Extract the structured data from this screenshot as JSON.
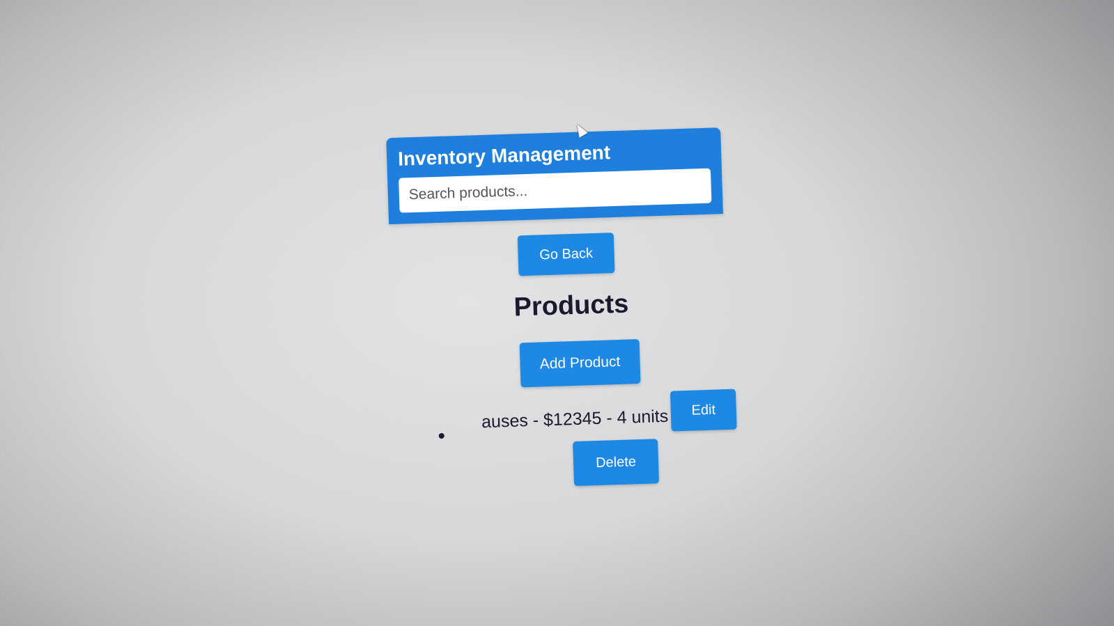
{
  "header": {
    "title": "Inventory Management",
    "search_placeholder": "Search products..."
  },
  "actions": {
    "go_back_label": "Go Back",
    "add_product_label": "Add Product"
  },
  "products_section": {
    "heading": "Products",
    "items": [
      {
        "text": "auses - $12345 - 4 units",
        "edit_label": "Edit",
        "delete_label": "Delete"
      }
    ]
  },
  "colors": {
    "header_bg": "#1e7fdc",
    "button_bg": "#1e88e5",
    "button_text": "#ffffff",
    "heading_text": "#1a1a2e"
  },
  "icons": {
    "cursor": "mouse-pointer-icon",
    "bullet": "list-bullet-icon"
  }
}
